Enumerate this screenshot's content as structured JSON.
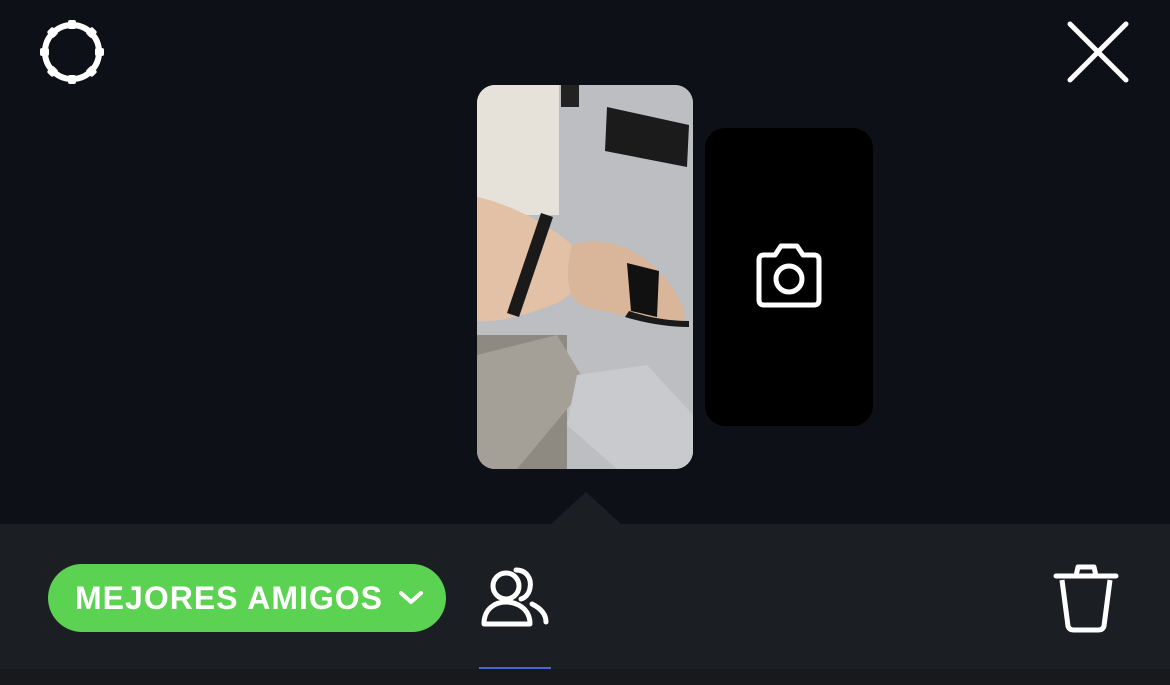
{
  "top_bar": {
    "settings_icon": "gear-icon",
    "close_icon": "close-icon"
  },
  "stories": {
    "thumbnail": {
      "type": "photo"
    },
    "add_story": {
      "icon": "camera-icon"
    }
  },
  "bottom_panel": {
    "audience_button": {
      "label": "MEJORES AMIGOS",
      "icon": "chevron-down-icon",
      "color": "#5bd251"
    },
    "people_icon": "people-icon",
    "delete_icon": "trash-icon"
  },
  "colors": {
    "background": "#0d1117",
    "panel": "#1b1e23",
    "accent_green": "#5bd251",
    "indicator_blue": "#4a64d8"
  }
}
